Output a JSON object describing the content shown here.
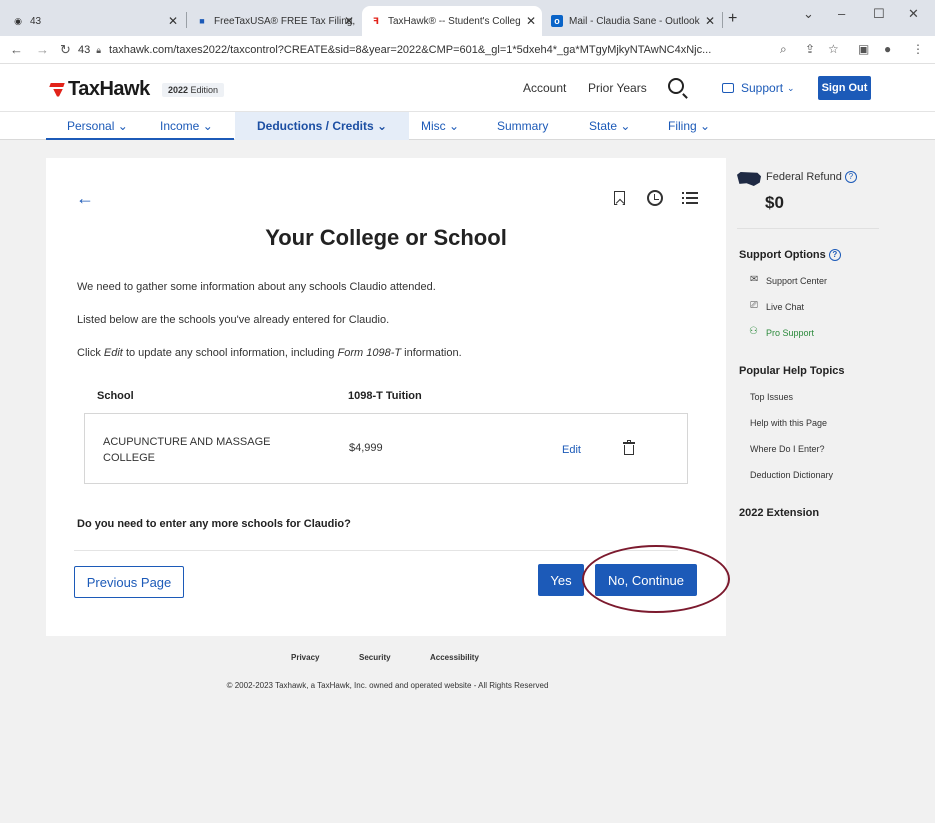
{
  "browser": {
    "tabs": [
      {
        "title": "43",
        "active": false
      },
      {
        "title": "FreeTaxUSA® FREE Tax Filing,",
        "active": false
      },
      {
        "title": "TaxHawk® -- Student's Colleg",
        "active": true
      },
      {
        "title": "Mail - Claudia Sane - Outlook",
        "active": false
      }
    ],
    "url": "taxhawk.com/taxes2022/taxcontrol?CREATE&sid=8&year=2022&CMP=601&_gl=1*5dxeh4*_ga*MTgyMjkyNTAwNC4xNjc...",
    "tab_count": "43"
  },
  "header": {
    "logo_text": "TaxHawk",
    "edition_year": "2022",
    "edition_label": "Edition",
    "links": {
      "account": "Account",
      "prior_years": "Prior Years"
    },
    "support_label": "Support",
    "signout_label": "Sign Out"
  },
  "nav": {
    "items": [
      {
        "label": "Personal",
        "active": false
      },
      {
        "label": "Income",
        "active": false
      },
      {
        "label": "Deductions / Credits",
        "active": true
      },
      {
        "label": "Misc",
        "active": false
      },
      {
        "label": "Summary",
        "active": false
      },
      {
        "label": "State",
        "active": false
      },
      {
        "label": "Filing",
        "active": false
      }
    ]
  },
  "main": {
    "title": "Your College or School",
    "intro": "We need to gather some information about any schools Claudio attended.",
    "listed_text": "Listed below are the schools you've already entered for Claudio.",
    "click_pre": "Click",
    "click_edit": "Edit",
    "click_mid": "to update any school information, including",
    "click_form": "Form 1098-T",
    "click_post": "information.",
    "table": {
      "headers": [
        "School",
        "1098-T Tuition"
      ],
      "rows": [
        {
          "school": "ACUPUNCTURE AND MASSAGE COLLEGE",
          "tuition": "$4,999",
          "edit_label": "Edit"
        }
      ]
    },
    "question": "Do you need to enter any more schools for Claudio?",
    "buttons": {
      "previous": "Previous Page",
      "yes": "Yes",
      "no": "No, Continue"
    }
  },
  "sidebar": {
    "refund_label": "Federal Refund",
    "refund_amount": "$0",
    "support_heading": "Support Options",
    "support_items": [
      "Support Center",
      "Live Chat",
      "Pro Support"
    ],
    "help_heading": "Popular Help Topics",
    "help_items": [
      "Top Issues",
      "Help with this Page",
      "Where Do I Enter?",
      "Deduction Dictionary"
    ],
    "extension_heading": "2022 Extension"
  },
  "footer": {
    "links": [
      "Privacy",
      "Security",
      "Accessibility"
    ],
    "copyright": "© 2002-2023 Taxhawk, a TaxHawk, Inc. owned and operated website - All Rights Reserved"
  },
  "colors": {
    "brand_blue": "#1c5ab8",
    "logo_red": "#e2231a",
    "annotation_ring": "#7c1a2e",
    "pro_support_green": "#2c8a3c"
  }
}
